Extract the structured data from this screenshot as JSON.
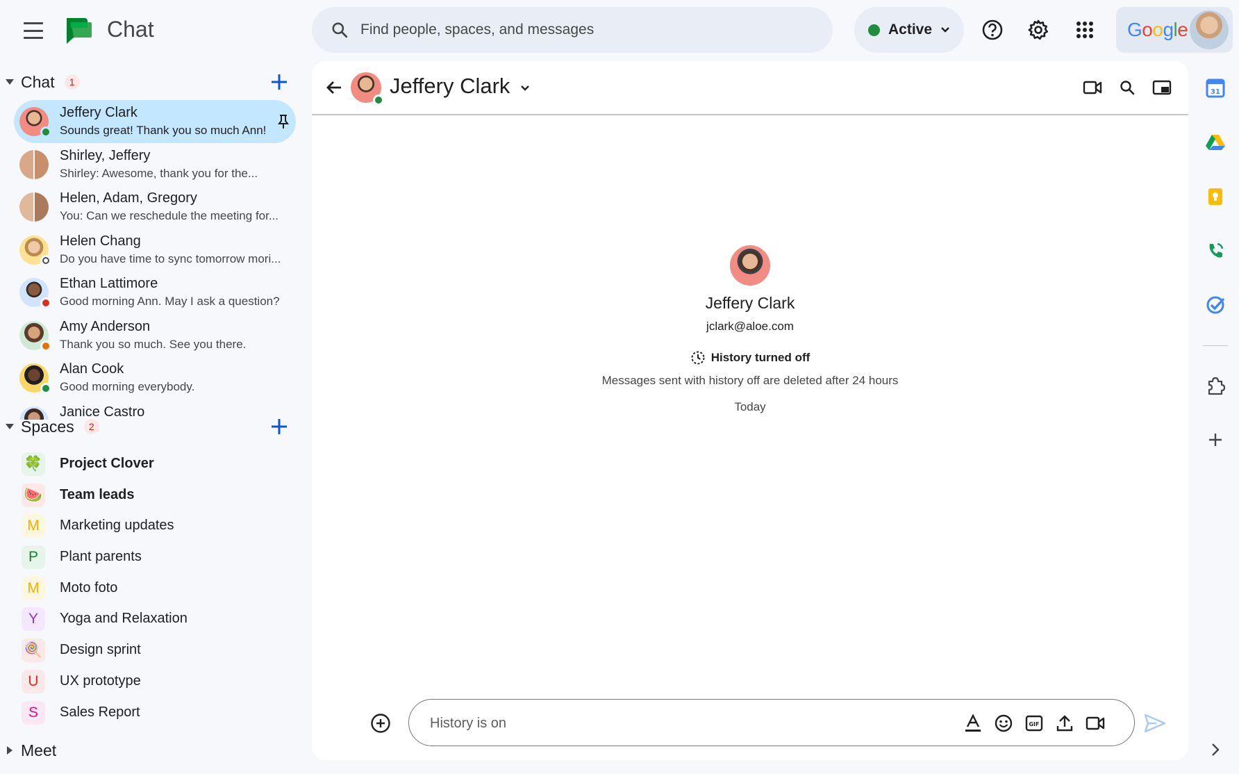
{
  "app": {
    "title": "Chat"
  },
  "search": {
    "placeholder": "Find people, spaces, and messages"
  },
  "status": {
    "label": "Active"
  },
  "account": {
    "brand": "Google"
  },
  "chat_section": {
    "title": "Chat",
    "unread_count": "1",
    "items": [
      {
        "name": "Jeffery Clark",
        "preview": "Sounds great! Thank you so much Ann!",
        "active": true,
        "pinned": true,
        "presence": "#1e8e3e"
      },
      {
        "name": "Shirley, Jeffery",
        "preview": "Shirley: Awesome, thank you for the...",
        "active": false,
        "pinned": false,
        "presence": ""
      },
      {
        "name": "Helen, Adam, Gregory",
        "preview": "You: Can we reschedule the meeting for...",
        "active": false,
        "pinned": false,
        "presence": ""
      },
      {
        "name": "Helen Chang",
        "preview": "Do you have time to sync tomorrow mori...",
        "active": false,
        "pinned": false,
        "presence": "#ffffff"
      },
      {
        "name": "Ethan Lattimore",
        "preview": "Good morning Ann. May I ask a question?",
        "active": false,
        "pinned": false,
        "presence": "#d93025"
      },
      {
        "name": "Amy Anderson",
        "preview": "Thank you so much. See you there.",
        "active": false,
        "pinned": false,
        "presence": "#e37400"
      },
      {
        "name": "Alan Cook",
        "preview": "Good morning everybody.",
        "active": false,
        "pinned": false,
        "presence": "#1e8e3e"
      },
      {
        "name": "Janice Castro",
        "preview": "",
        "active": false,
        "pinned": false,
        "presence": ""
      }
    ]
  },
  "spaces_section": {
    "title": "Spaces",
    "unread_count": "2",
    "items": [
      {
        "name": "Project Clover",
        "bold": true,
        "badge": "🍀",
        "badge_bg": "#e6f4ea",
        "badge_color": "#1e8e3e"
      },
      {
        "name": "Team leads",
        "bold": true,
        "badge": "🍉",
        "badge_bg": "#fce8e6",
        "badge_color": "#d93025"
      },
      {
        "name": "Marketing updates",
        "bold": false,
        "badge": "M",
        "badge_bg": "#fef7e0",
        "badge_color": "#f9ab00"
      },
      {
        "name": "Plant parents",
        "bold": false,
        "badge": "P",
        "badge_bg": "#e6f4ea",
        "badge_color": "#188038"
      },
      {
        "name": "Moto foto",
        "bold": false,
        "badge": "M",
        "badge_bg": "#fef7e0",
        "badge_color": "#f9ab00"
      },
      {
        "name": "Yoga and Relaxation",
        "bold": false,
        "badge": "Y",
        "badge_bg": "#f3e8fd",
        "badge_color": "#9334e6"
      },
      {
        "name": "Design sprint",
        "bold": false,
        "badge": "🍭",
        "badge_bg": "#fce8e6",
        "badge_color": "#d93025"
      },
      {
        "name": "UX prototype",
        "bold": false,
        "badge": "U",
        "badge_bg": "#fce8e6",
        "badge_color": "#d93025"
      },
      {
        "name": "Sales Report",
        "bold": false,
        "badge": "S",
        "badge_bg": "#fde7f3",
        "badge_color": "#d01884"
      }
    ]
  },
  "meet_section": {
    "title": "Meet"
  },
  "conversation": {
    "name": "Jeffery Clark",
    "email": "jclark@aloe.com",
    "history_title": "History turned off",
    "history_note": "Messages sent with history off are deleted after 24 hours",
    "date_divider": "Today"
  },
  "composer": {
    "placeholder": "History is on"
  },
  "colors": {
    "accent": "#0b57d0",
    "active_bg": "#c2e7ff",
    "background": "#f6f8fc",
    "online": "#1e8e3e"
  },
  "icons": {
    "top": [
      "menu-icon",
      "chat-logo-icon",
      "search-icon",
      "chevron-down-icon",
      "help-icon",
      "settings-icon",
      "apps-grid-icon"
    ],
    "header": [
      "back-arrow-icon",
      "video-call-icon",
      "search-icon",
      "pop-out-icon"
    ],
    "composer": [
      "add-circle-icon",
      "format-text-icon",
      "emoji-icon",
      "gif-icon",
      "upload-icon",
      "video-meeting-icon",
      "send-icon"
    ],
    "rail": [
      "calendar-icon",
      "drive-icon",
      "keep-icon",
      "voice-icon",
      "tasks-icon",
      "addons-icon",
      "add-icon",
      "expand-icon"
    ]
  }
}
